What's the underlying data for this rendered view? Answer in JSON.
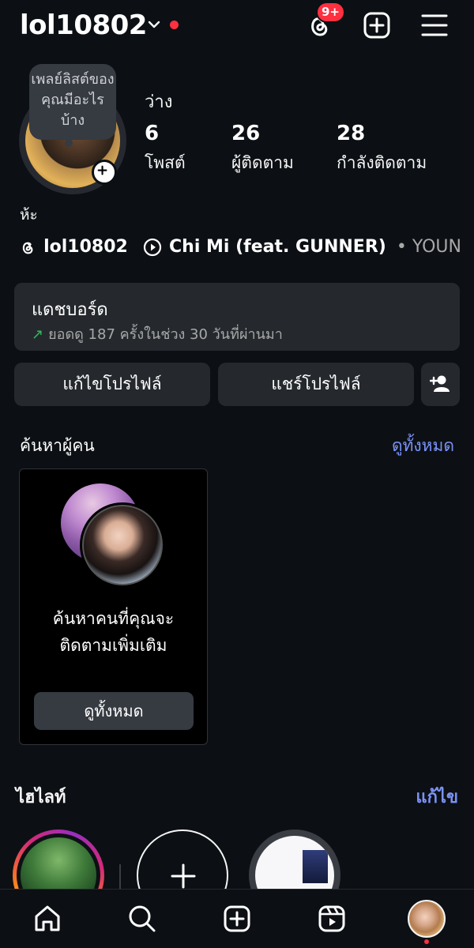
{
  "header": {
    "username": "lol10802",
    "notification_badge": "9+"
  },
  "profile": {
    "note": "เพลย์ลิสต์ของคุณมีอะไรบ้าง",
    "status": "ว่าง",
    "stats": [
      {
        "num": "6",
        "label": "โพสต์"
      },
      {
        "num": "26",
        "label": "ผู้ติดตาม"
      },
      {
        "num": "28",
        "label": "กำลังติดตาม"
      }
    ],
    "bio": "ห้ะ",
    "threads_handle": "lol10802",
    "song": "Chi Mi (feat. GUNNER)",
    "artist": "• YOUNG..."
  },
  "dashboard": {
    "title": "แดชบอร์ด",
    "subtitle": "ยอดดู 187 ครั้งในช่วง 30 วันที่ผ่านมา",
    "arrow": "↗"
  },
  "actions": {
    "edit_profile": "แก้ไขโปรไฟล์",
    "share_profile": "แชร์โปรไฟล์"
  },
  "discover": {
    "title": "ค้นหาผู้คน",
    "see_all": "ดูทั้งหมด",
    "card_line1": "ค้นหาคนที่คุณจะ",
    "card_line2": "ติดตามเพิ่มเติม",
    "card_button": "ดูทั้งหมด"
  },
  "highlights": {
    "title": "ไฮไลท์",
    "edit": "แก้ไข"
  },
  "colors": {
    "background": "#0c1014",
    "surface": "#25292e",
    "link": "#7b92f7",
    "notification": "#ff3040"
  }
}
